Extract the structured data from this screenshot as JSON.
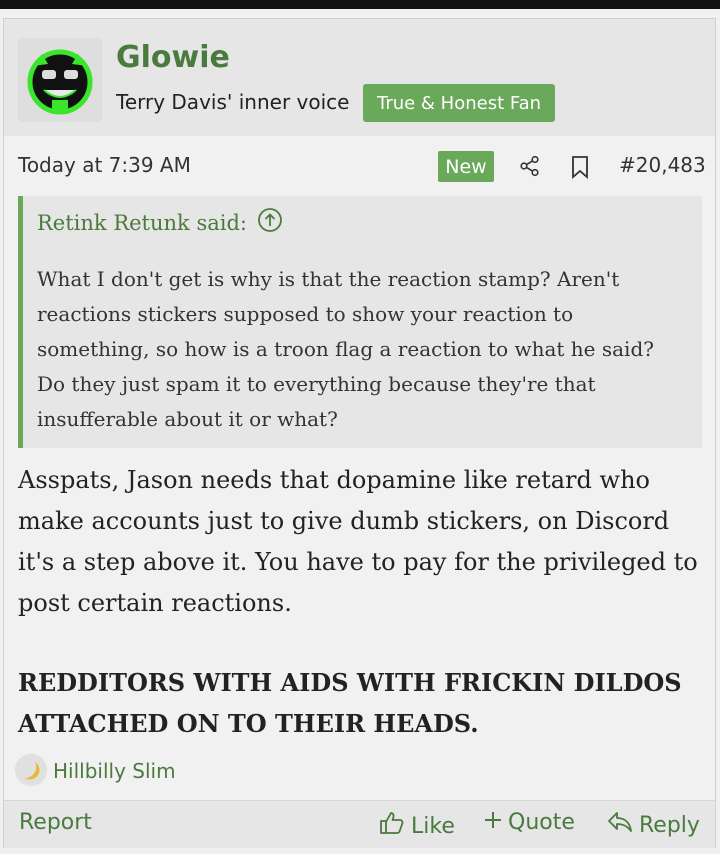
{
  "user": {
    "name": "Glowie",
    "title": "Terry Davis' inner voice",
    "banner": "True & Honest Fan"
  },
  "post": {
    "date": "Today at 7:39 AM",
    "new_badge": "New",
    "number": "#20,483"
  },
  "quote": {
    "author_line": "Retink Retunk said:",
    "text": "What I don't get is why is that the reaction stamp? Aren't reactions stickers supposed to show your reaction to something, so how is a troon flag a reaction to what he said? Do they just spam it to everything because they're that insufferable about it or what?"
  },
  "body": {
    "paragraph": "Asspats, Jason needs that dopamine like retard who make accounts just to give dumb stickers, on Discord it's a step above it. You have to pay for the privileged to post certain reactions.",
    "bold": "REDDITORS WITH AIDS WITH FRICKIN DILDOS ATTACHED ON TO THEIR HEADS."
  },
  "reactions": {
    "user": "Hillbilly Slim"
  },
  "footer": {
    "report": "Report",
    "like": "Like",
    "quote": "Quote",
    "reply": "Reply"
  },
  "colors": {
    "accent": "#6aa85a",
    "link": "#4a7a3d",
    "background": "#f0f0f0"
  },
  "icons": [
    "share-icon",
    "bookmark-icon",
    "circle-arrow-up-icon",
    "thumbs-up-icon",
    "plus-icon",
    "reply-arrow-icon"
  ]
}
